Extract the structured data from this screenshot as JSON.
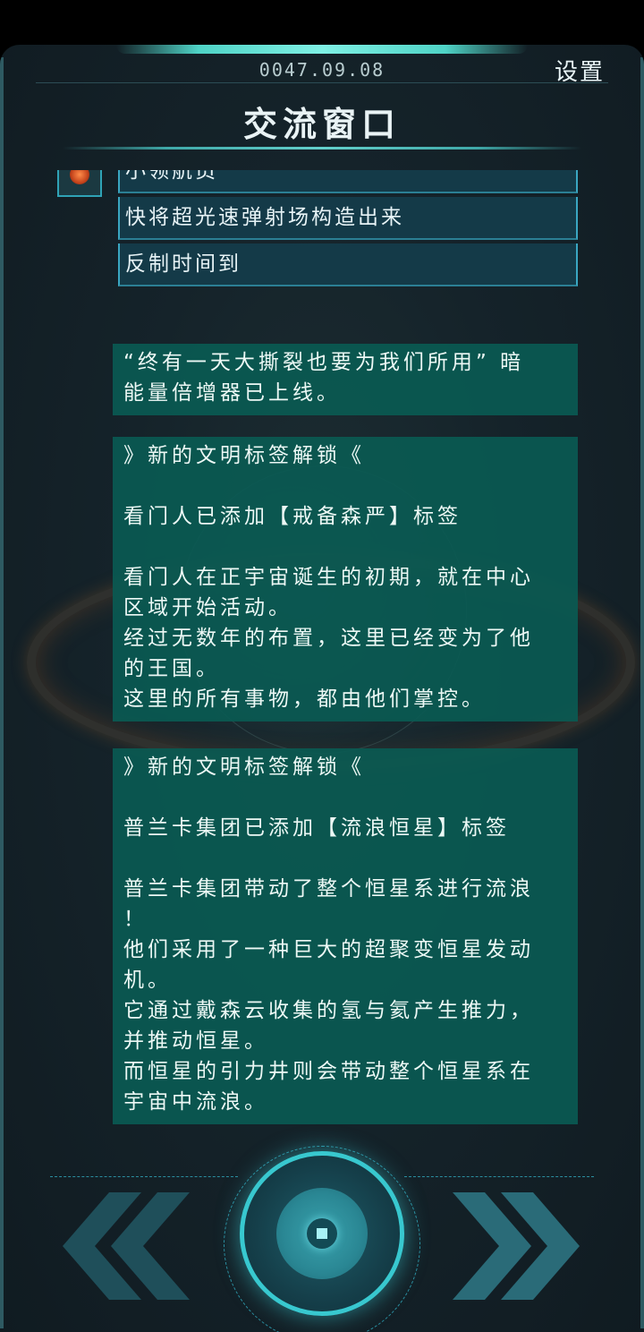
{
  "header": {
    "date": "0047.09.08",
    "settings_label": "设置",
    "title": "交流窗口"
  },
  "messages": [
    {
      "text": "小领航员"
    },
    {
      "text": "快将超光速弹射场构造出来"
    },
    {
      "text": "反制时间到"
    }
  ],
  "cards": [
    {
      "lines": [
        "“终有一天大撕裂也要为我们所用” 暗",
        "能量倍增器已上线。"
      ]
    },
    {
      "heading": "》新的文明标签解锁《",
      "tag_line": "看门人已添加【戒备森严】标签",
      "body": [
        "看门人在正宇宙诞生的初期，就在中心",
        "区域开始活动。",
        "经过无数年的布置，这里已经变为了他",
        "的王国。",
        "这里的所有事物，都由他们掌控。"
      ]
    },
    {
      "heading": "》新的文明标签解锁《",
      "tag_line": "普兰卡集团已添加【流浪恒星】标签",
      "body": [
        "普兰卡集团带动了整个恒星系进行流浪",
        "！",
        "他们采用了一种巨大的超聚变恒星发动",
        "机。",
        "它通过戴森云收集的氢与氦产生推力，",
        "并推动恒星。",
        "而恒星的引力井则会带动整个恒星系在",
        "宇宙中流浪。"
      ]
    }
  ],
  "controls": {
    "prev_icon": "double-chevron-left-icon",
    "next_icon": "double-chevron-right-icon",
    "center_icon": "center-dial-icon"
  },
  "colors": {
    "card_bg": "#0a5a52",
    "message_bg": "#143a48",
    "accent": "#38c8cf"
  }
}
